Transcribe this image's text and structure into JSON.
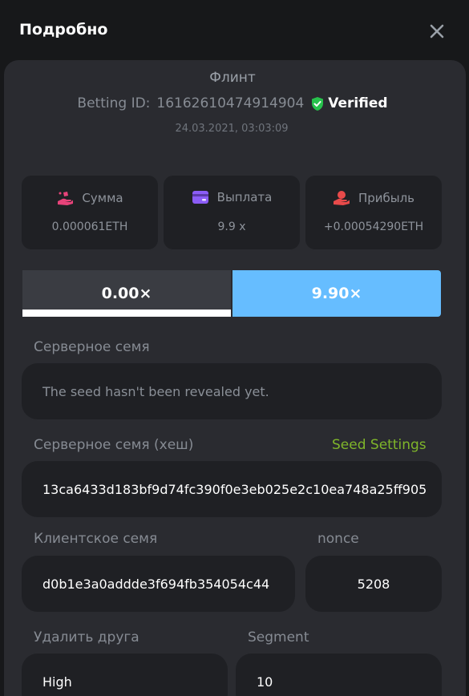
{
  "header": {
    "title": "Подробно"
  },
  "game": {
    "name": "Флинт",
    "betting_id_label": "Betting ID:",
    "betting_id": "16162610474914904",
    "verified_label": "Verified",
    "date": "24.03.2021, 03:03:09"
  },
  "stats": [
    {
      "label": "Сумма",
      "value": "0.000061ETH",
      "icon": "money-hand-icon",
      "color": "#e8437a"
    },
    {
      "label": "Выплата",
      "value": "9.9 x",
      "icon": "card-icon",
      "color": "#8b5cf6"
    },
    {
      "label": "Прибыль",
      "value": "+0.00054290ETH",
      "icon": "profit-hand-icon",
      "color": "#e84a4a"
    }
  ],
  "tabs": [
    {
      "label": "0.00×"
    },
    {
      "label": "9.90×"
    }
  ],
  "server_seed": {
    "label": "Серверное семя",
    "value": "The seed hasn't been revealed yet."
  },
  "server_seed_hash": {
    "label": "Серверное семя (хеш)",
    "settings_link": "Seed Settings",
    "value": "13ca6433d183bf9d74fc390f0e3eb025e2c10ea748a25ff905"
  },
  "client_seed": {
    "label": "Клиентское семя",
    "value": "d0b1e3a0addde3f694fb354054c44"
  },
  "nonce": {
    "label": "nonce",
    "value": "5208"
  },
  "risk": {
    "label": "Удалить друга",
    "value": "High"
  },
  "segment": {
    "label": "Segment",
    "value": "10"
  },
  "colors": {
    "accent_blue": "#66bdff",
    "verified_green": "#27c24c",
    "link_green": "#7fb62a"
  }
}
